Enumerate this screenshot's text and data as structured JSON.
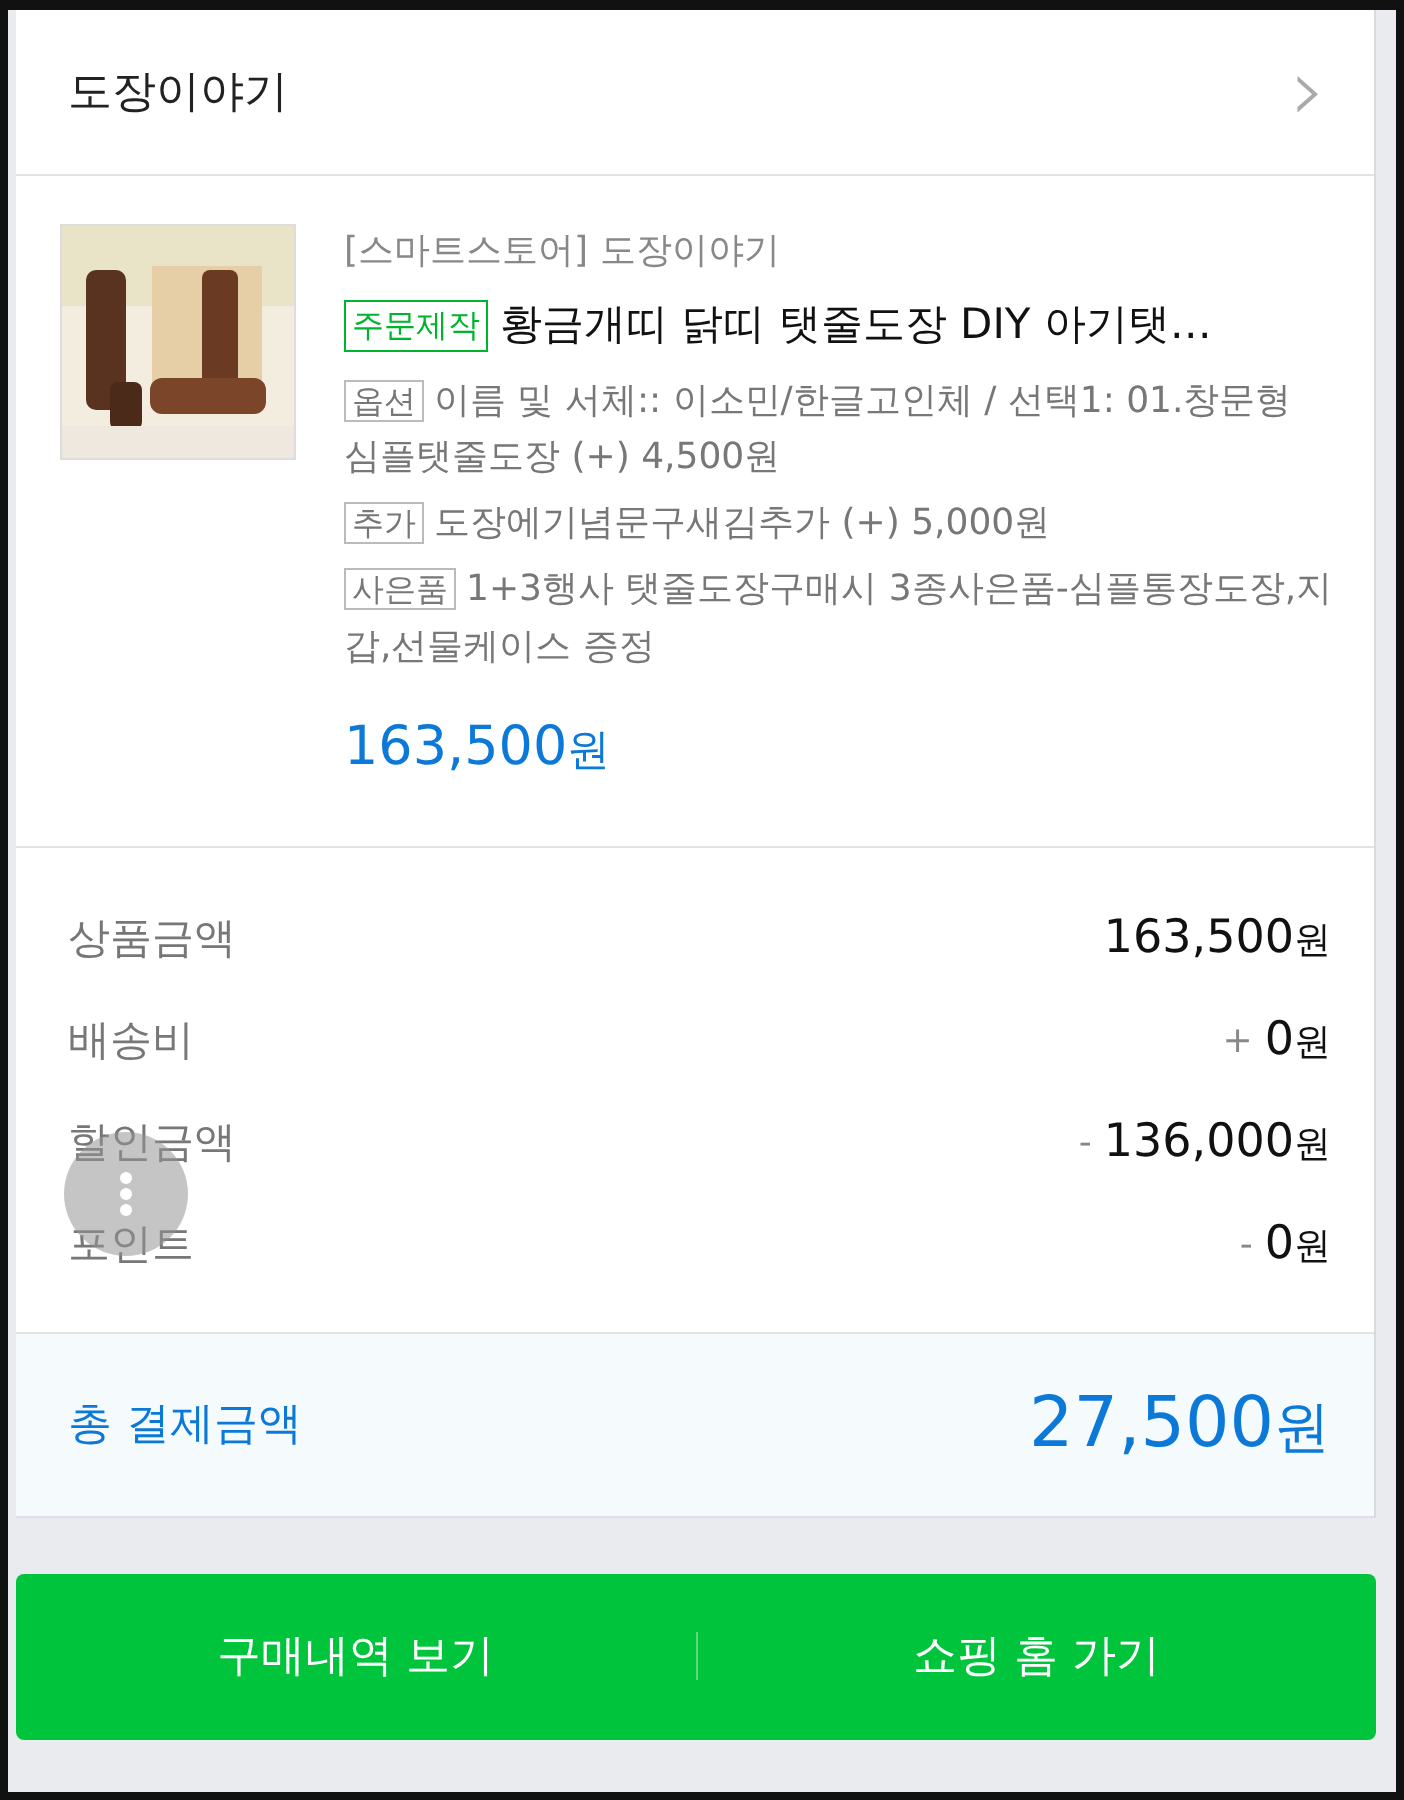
{
  "store_header": {
    "title": "도장이야기",
    "chevron": "›"
  },
  "product": {
    "store_label": "[스마트스토어] 도장이야기",
    "badge": "주문제작",
    "name": "황금개띠 닭띠 탯줄도장 DIY 아기탯…",
    "details": [
      {
        "tag": "옵션",
        "text": "이름 및 서체:: 이소민/한글고인체 / 선택1: 01.창문형 심플탯줄도장 (+) 4,500원"
      },
      {
        "tag": "추가",
        "text": "도장에기념문구새김추가 (+) 5,000원"
      },
      {
        "tag": "사은품",
        "text": "1+3행사 탯줄도장구매시 3종사은품-심플통장도장,지갑,선물케이스 증정"
      }
    ],
    "price": {
      "amount": "163,500",
      "unit": "원"
    }
  },
  "summary": [
    {
      "label": "상품금액",
      "amount": "163,500",
      "unit": "원"
    },
    {
      "label": "배송비",
      "sign": "+",
      "amount": "0",
      "unit": "원"
    },
    {
      "label": "할인금액",
      "sign": "-",
      "amount": "136,000",
      "unit": "원"
    },
    {
      "label": "포인트",
      "sign": "-",
      "amount": "0",
      "unit": "원"
    }
  ],
  "total": {
    "label": "총 결제금액",
    "amount": "27,500",
    "unit": "원"
  },
  "buttons": [
    "구매내역 보기",
    "쇼핑 홈 가기"
  ]
}
